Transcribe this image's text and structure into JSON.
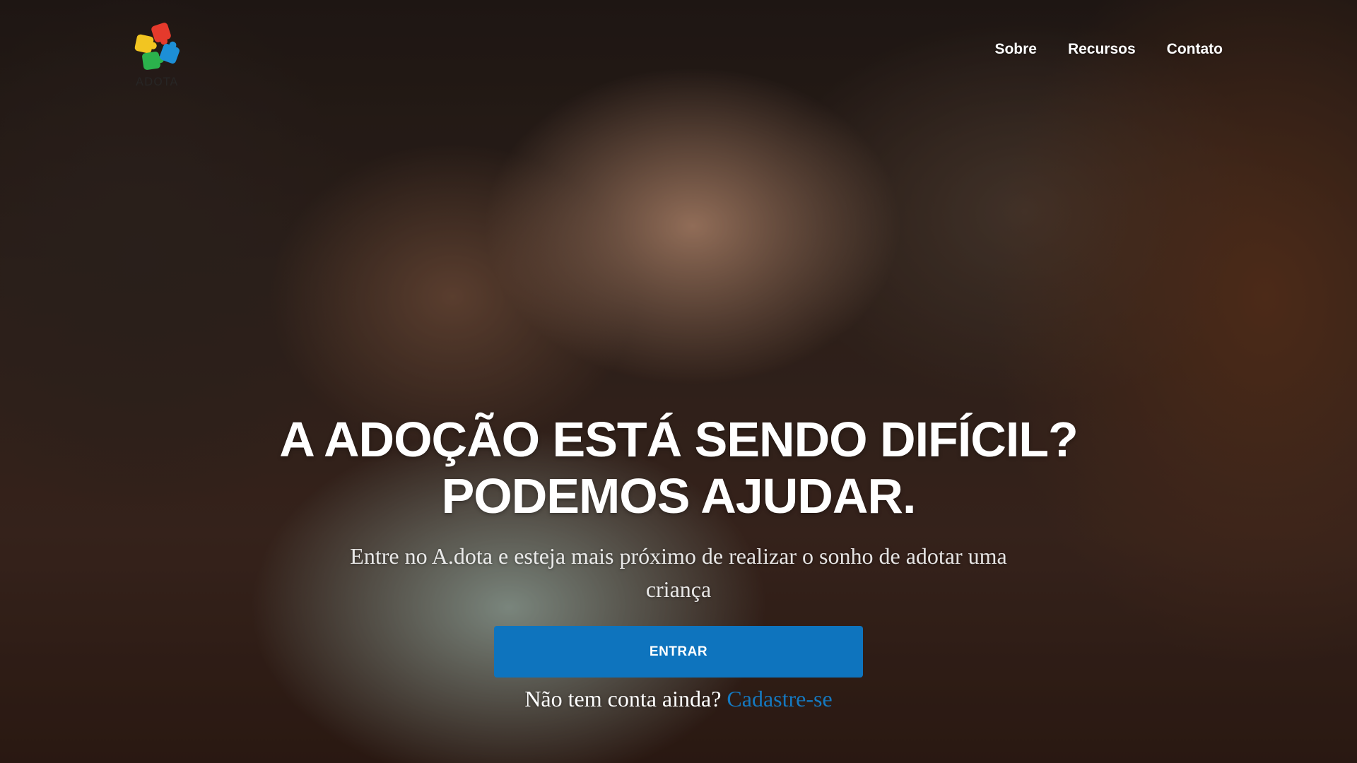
{
  "brand": {
    "logo_text": "ADOTA",
    "logo_colors": [
      "#f2c521",
      "#e53a2c",
      "#2bb24c",
      "#1d8fd6"
    ]
  },
  "nav": {
    "items": [
      {
        "label": "Sobre"
      },
      {
        "label": "Recursos"
      },
      {
        "label": "Contato"
      }
    ]
  },
  "hero": {
    "headline_line1": "A ADOÇÃO ESTÁ SENDO DIFÍCIL?",
    "headline_line2": "PODEMOS AJUDAR.",
    "subheadline": "Entre no A.dota e esteja mais próximo de realizar o sonho de adotar uma criança",
    "login_button": "ENTRAR",
    "signup_prompt": "Não tem conta ainda?",
    "signup_link": "Cadastre-se"
  },
  "colors": {
    "primary_button": "#0e74be",
    "link": "#1578bf",
    "text_on_photo": "#ffffff"
  }
}
